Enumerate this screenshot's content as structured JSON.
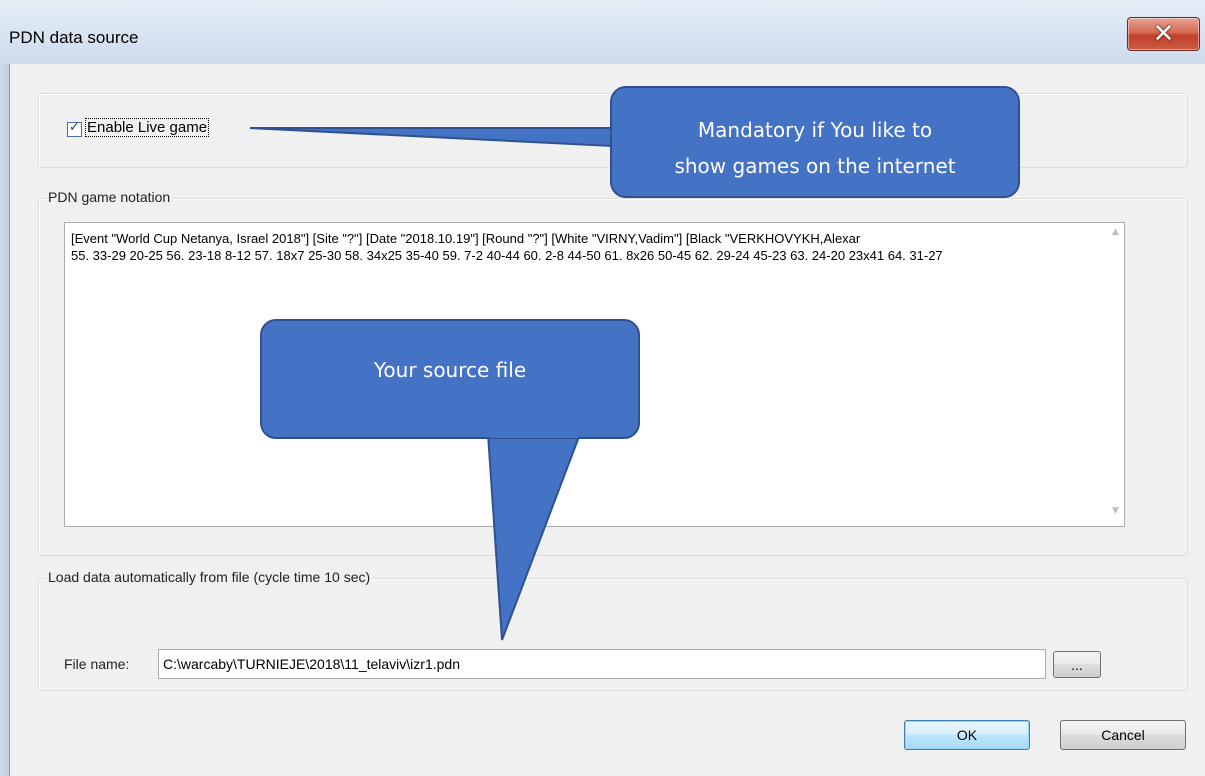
{
  "window": {
    "title": "PDN data source",
    "close_icon": "close-icon"
  },
  "live_group": {
    "checkbox_label": "Enable Live game",
    "checked": true
  },
  "notation_group": {
    "label": "PDN game notation",
    "lines": [
      "[Event \"World Cup Netanya, Israel 2018\"] [Site \"?\"] [Date \"2018.10.19\"] [Round \"?\"] [White \"VIRNY,Vadim\"] [Black \"VERKHOVYKH,Alexar",
      "55. 33-29 20-25 56. 23-18 8-12 57. 18x7 25-30 58. 34x25 35-40 59. 7-2 40-44 60. 2-8 44-50 61. 8x26 50-45 62. 29-24 45-23 63. 24-20 23x41 64. 31-27"
    ]
  },
  "file_group": {
    "label": "Load data automatically from file (cycle time 10 sec)",
    "field_label": "File name:",
    "file_value": "C:\\warcaby\\TURNIEJE\\2018\\11_telaviv\\izr1.pdn",
    "browse_label": "..."
  },
  "buttons": {
    "ok": "OK",
    "cancel": "Cancel"
  },
  "annotations": {
    "live_callout": "Mandatory if You like to show games on the internet",
    "live_callout_line1": "Mandatory if You like to",
    "live_callout_line2": "show games on the internet",
    "file_callout": "Your source file",
    "callout_color": "#4472c4"
  }
}
